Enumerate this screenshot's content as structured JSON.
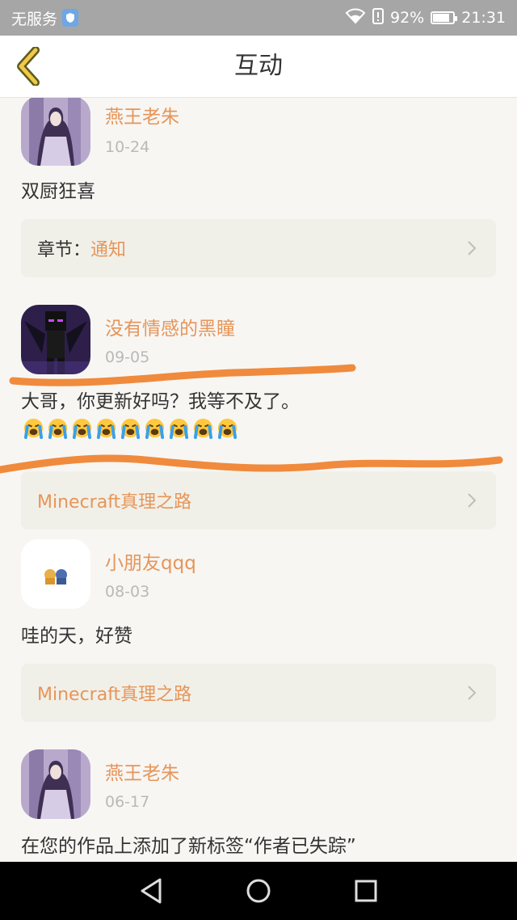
{
  "status_bar": {
    "carrier": "无服务",
    "battery_percent": "92%",
    "battery_level": 0.92,
    "time": "21:31"
  },
  "nav": {
    "title": "互动",
    "back_icon": "chevron-left-icon"
  },
  "feed": [
    {
      "user": "燕王老朱",
      "date": "10-24",
      "message": "双厨狂喜",
      "card_prefix": "章节：",
      "card_text": "通知"
    },
    {
      "user": "没有情感的黑瞳",
      "date": "09-05",
      "message": "大哥，你更新好吗？我等不及了。",
      "emoji": "loudly-crying-face",
      "emoji_count": 9,
      "card_text": "Minecraft真理之路"
    },
    {
      "user": "小朋友qqq",
      "date": "08-03",
      "message": "哇的天，好赞",
      "card_text": "Minecraft真理之路"
    },
    {
      "user": "燕王老朱",
      "date": "06-17",
      "message": "在您的作品上添加了新标签“作者已失踪”"
    }
  ],
  "colors": {
    "accent": "#e6955a",
    "scribble": "#f08a3c",
    "background": "#f7f6f3",
    "card": "#f1f0e8"
  },
  "system_nav": {
    "back": "triangle-back-icon",
    "home": "circle-home-icon",
    "recents": "square-recents-icon"
  }
}
